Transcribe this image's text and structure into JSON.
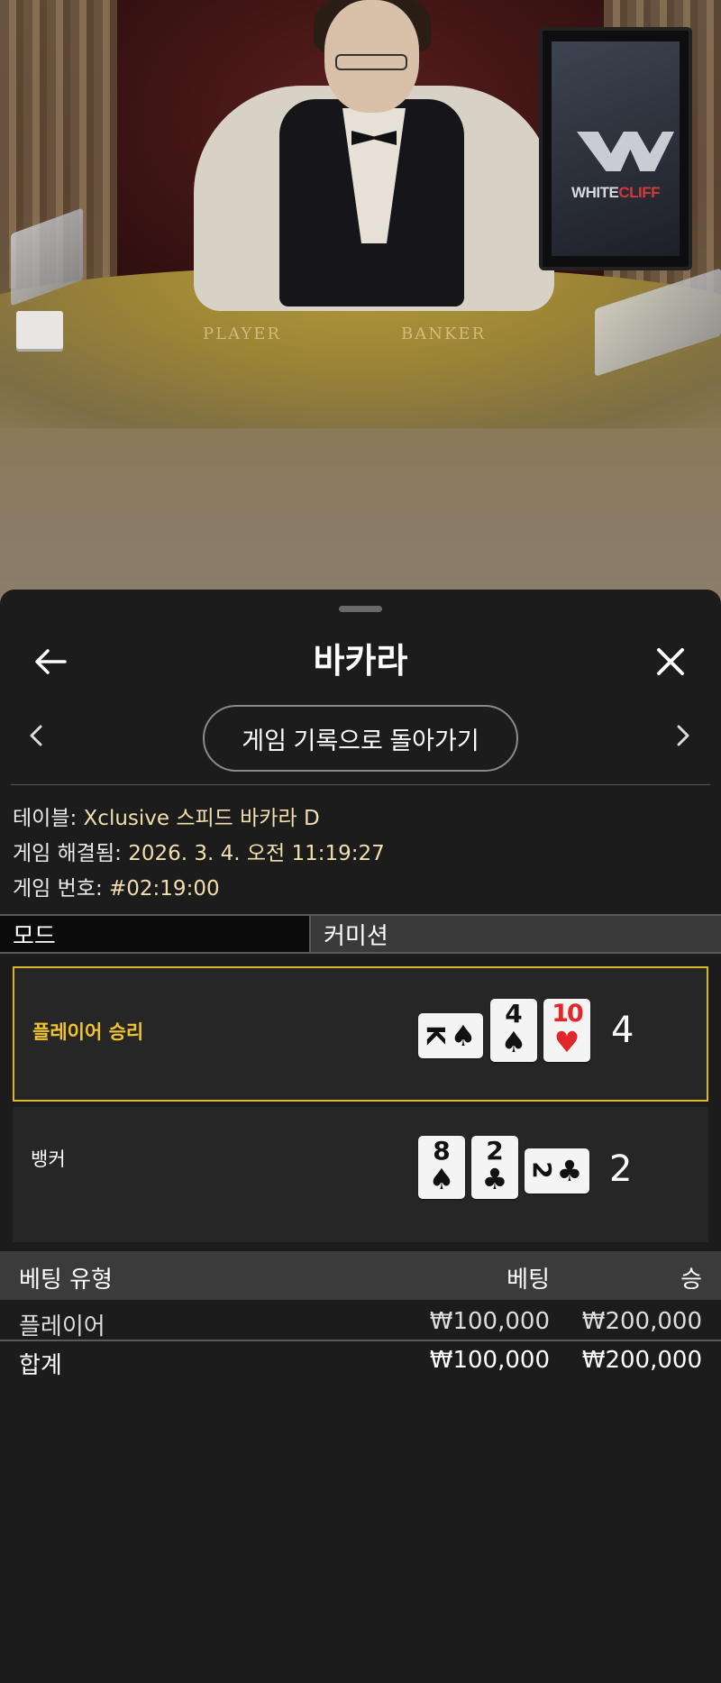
{
  "video": {
    "felt_player": "PLAYER",
    "felt_banker": "BANKER",
    "brand_logo": {
      "part1": "WHITE",
      "part2": "CLIFF"
    },
    "colors": {
      "brand_red": "#d23a3a",
      "felt": "#b59a3a"
    }
  },
  "header": {
    "title": "바카라",
    "back_icon": "arrow-left-icon",
    "close_icon": "close-icon"
  },
  "nav": {
    "prev_icon": "chevron-left-icon",
    "next_icon": "chevron-right-icon",
    "return_label": "게임 기록으로 돌아가기"
  },
  "info": {
    "table_label": "테이블:",
    "table_value": "Xclusive 스피드 바카라 D",
    "resolved_label": "게임 해결됨:",
    "resolved_value": "2026. 3. 4. 오전 11:19:27",
    "game_no_label": "게임 번호:",
    "game_no_value": "#02:19:00"
  },
  "tabs": {
    "mode": "모드",
    "commission": "커미션"
  },
  "hands": {
    "player": {
      "label": "플레이어 승리",
      "total": "4",
      "winner": true,
      "cards": [
        {
          "rank": "K",
          "suit": "♠",
          "color": "black",
          "orientation": "horizontal"
        },
        {
          "rank": "4",
          "suit": "♠",
          "color": "black",
          "orientation": "vertical"
        },
        {
          "rank": "10",
          "suit": "♥",
          "color": "red",
          "orientation": "vertical"
        }
      ]
    },
    "banker": {
      "label": "뱅커",
      "total": "2",
      "winner": false,
      "cards": [
        {
          "rank": "8",
          "suit": "♠",
          "color": "black",
          "orientation": "vertical"
        },
        {
          "rank": "2",
          "suit": "♣",
          "color": "black",
          "orientation": "vertical"
        },
        {
          "rank": "2",
          "suit": "♣",
          "color": "black",
          "orientation": "horizontal"
        }
      ]
    }
  },
  "bets": {
    "headers": {
      "type": "베팅 유형",
      "bet": "베팅",
      "win": "승"
    },
    "rows": [
      {
        "type": "플레이어",
        "bet": "₩100,000",
        "win": "₩200,000"
      }
    ],
    "total": {
      "type": "합계",
      "bet": "₩100,000",
      "win": "₩200,000"
    }
  },
  "colors": {
    "accent_gold": "#f0c330",
    "winner_border": "#d8b92b",
    "info_value": "#f2dfae",
    "sheet_bg": "#1c1c1c"
  }
}
